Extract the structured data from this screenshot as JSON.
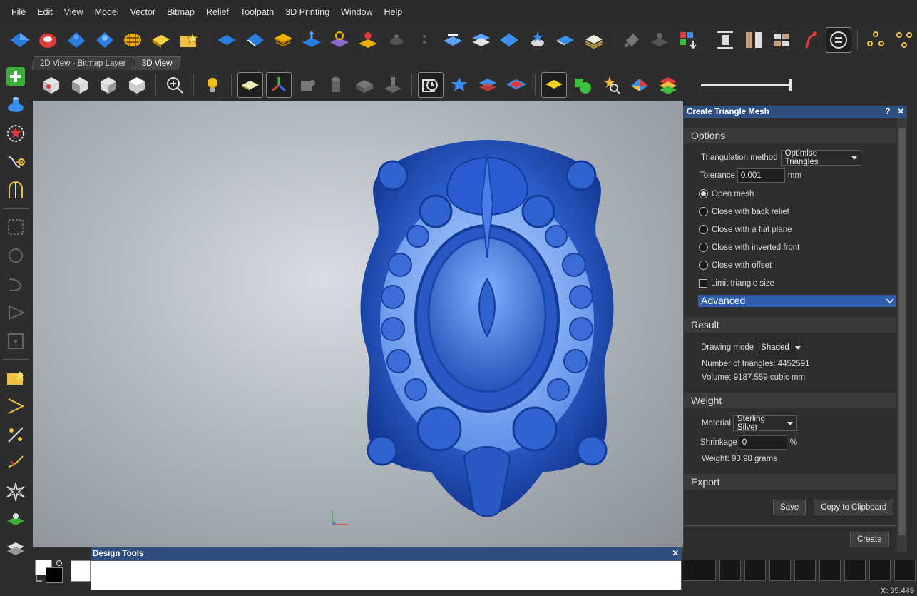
{
  "menu": [
    "File",
    "Edit",
    "View",
    "Model",
    "Vector",
    "Bitmap",
    "Relief",
    "Toolpath",
    "3D Printing",
    "Window",
    "Help"
  ],
  "tabs": [
    {
      "label": "2D View - Bitmap Layer",
      "active": false
    },
    {
      "label": "3D View",
      "active": true
    }
  ],
  "panel": {
    "title": "Create Triangle Mesh",
    "help_glyph": "?",
    "close_glyph": "✕",
    "options_header": "Options",
    "triangulation_label": "Triangulation method",
    "triangulation_value": "Optimise Triangles",
    "tolerance_label": "Tolerance",
    "tolerance_value": "0.001",
    "tolerance_unit": "mm",
    "radio_options": [
      "Open mesh",
      "Close with back relief",
      "Close with a flat plane",
      "Close with inverted front",
      "Close with offset"
    ],
    "radio_selected": 0,
    "limit_label": "Limit triangle size",
    "advanced_label": "Advanced",
    "result_header": "Result",
    "drawing_mode_label": "Drawing mode",
    "drawing_mode_value": "Shaded",
    "triangles_text": "Number of triangles: 4452591",
    "volume_text": "Volume: 9187.559 cubic mm",
    "weight_header": "Weight",
    "material_label": "Material",
    "material_value": "Sterling Silver",
    "shrinkage_label": "Shrinkage",
    "shrinkage_value": "0",
    "shrinkage_unit": "%",
    "weight_text": "Weight: 93.98 grams",
    "export_header": "Export",
    "save_label": "Save",
    "clipboard_label": "Copy to Clipboard",
    "create_label": "Create"
  },
  "design_tools": {
    "title": "Design Tools",
    "close_glyph": "✕"
  },
  "status": {
    "coord_text": "X: 35.449"
  },
  "colors": {
    "accent_title": "#2f4f80",
    "advanced_bar": "#2f5db0",
    "relief_blue": "#2f5fd0"
  }
}
